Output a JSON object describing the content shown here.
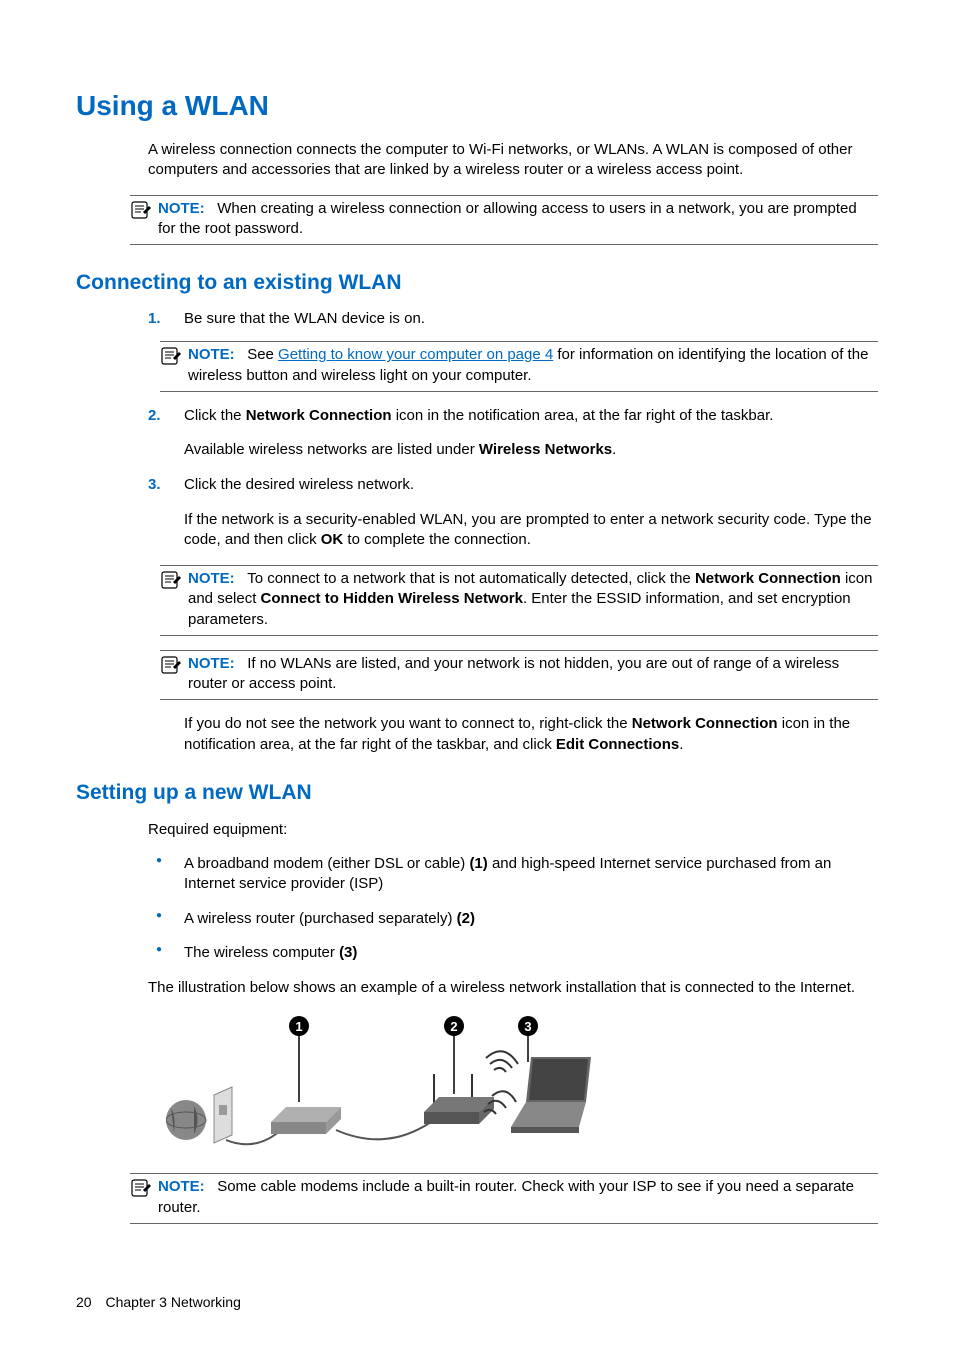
{
  "title": "Using a WLAN",
  "intro": "A wireless connection connects the computer to Wi-Fi networks, or WLANs. A WLAN is composed of other computers and accessories that are linked by a wireless router or a wireless access point.",
  "note1": {
    "label": "NOTE:",
    "text": "When creating a wireless connection or allowing access to users in a network, you are prompted for the root password."
  },
  "section1": {
    "title": "Connecting to an existing WLAN",
    "step1": {
      "num": "1.",
      "text": "Be sure that the WLAN device is on."
    },
    "note2": {
      "label": "NOTE:",
      "pre": "See ",
      "link": "Getting to know your computer on page 4",
      "post": " for information on identifying the location of the wireless button and wireless light on your computer."
    },
    "step2": {
      "num": "2.",
      "pre": "Click the ",
      "b1": "Network Connection",
      "post": " icon in the notification area, at the far right of the taskbar.",
      "para2a": "Available wireless networks are listed under ",
      "para2b": "Wireless Networks",
      "para2c": "."
    },
    "step3": {
      "num": "3.",
      "text": "Click the desired wireless network.",
      "para_a": "If the network is a security-enabled WLAN, you are prompted to enter a network security code. Type the code, and then click ",
      "para_b": "OK",
      "para_c": " to complete the connection."
    },
    "note3": {
      "label": "NOTE:",
      "t1": "To connect to a network that is not automatically detected, click the ",
      "b1": "Network Connection",
      "t2": " icon and select ",
      "b2": "Connect to Hidden Wireless Network",
      "t3": ". Enter the ESSID information, and set encryption parameters."
    },
    "note4": {
      "label": "NOTE:",
      "text": "If no WLANs are listed, and your network is not hidden, you are out of range of a wireless router or access point."
    },
    "post": {
      "t1": "If you do not see the network you want to connect to, right-click the ",
      "b1": "Network Connection",
      "t2": " icon in the notification area, at the far right of the taskbar, and click ",
      "b2": "Edit Connections",
      "t3": "."
    }
  },
  "section2": {
    "title": "Setting up a new WLAN",
    "req": "Required equipment:",
    "bullet1": {
      "t1": "A broadband modem (either DSL or cable) ",
      "b1": "(1)",
      "t2": " and high-speed Internet service purchased from an Internet service provider (ISP)"
    },
    "bullet2": {
      "t1": "A wireless router (purchased separately) ",
      "b1": "(2)"
    },
    "bullet3": {
      "t1": "The wireless computer ",
      "b1": "(3)"
    },
    "illus_text": "The illustration below shows an example of a wireless network installation that is connected to the Internet.",
    "note5": {
      "label": "NOTE:",
      "text": "Some cable modems include a built-in router. Check with your ISP to see if you need a separate router."
    }
  },
  "footer": {
    "page": "20",
    "chapter": "Chapter 3   Networking"
  }
}
